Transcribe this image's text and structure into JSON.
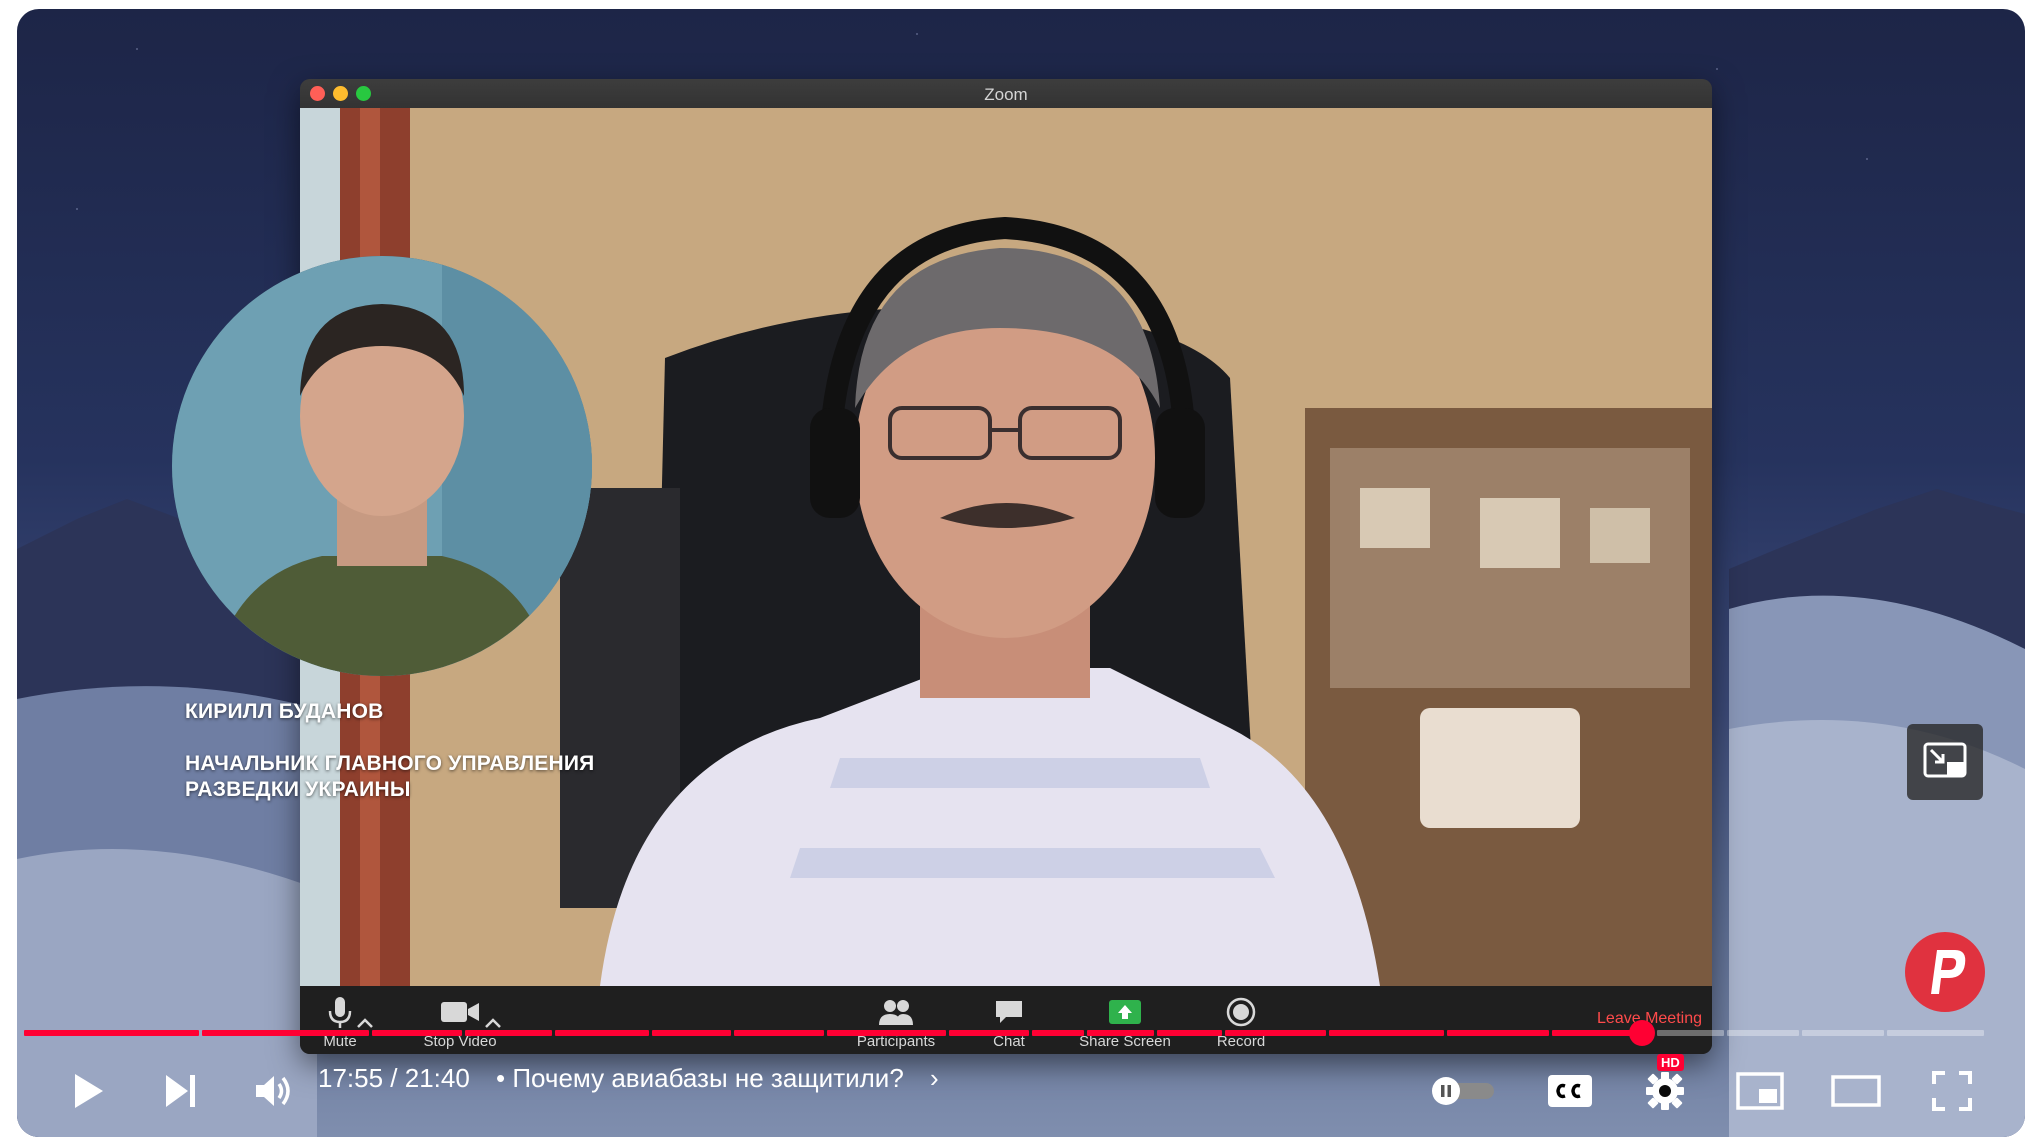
{
  "zoom": {
    "title": "Zoom",
    "toolbar": {
      "mute_label": "Mute",
      "stop_video_label": "Stop Video",
      "participants_label": "Participants",
      "chat_label": "Chat",
      "share_screen_label": "Share Screen",
      "record_label": "Record",
      "leave_label": "Leave Meeting"
    }
  },
  "overlay": {
    "name": "КИРИЛЛ БУДАНОВ",
    "position_line1": "НАЧАЛЬНИК ГЛАВНОГО УПРАВЛЕНИЯ",
    "position_line2": "РАЗВЕДКИ УКРАИНЫ"
  },
  "player": {
    "time": "17:55 / 21:40",
    "chapter_separator": "•",
    "chapter_title": "Почему авиабазы не защитили?",
    "chapter_chevron": "›",
    "hd_badge": "HD",
    "progress_fraction": 0.8256,
    "accent_color": "#ff0033",
    "icons": [
      "play-icon",
      "next-icon",
      "volume-icon",
      "autoplay-toggle-icon",
      "cc-icon",
      "settings-icon",
      "miniplayer-icon",
      "theater-icon",
      "fullscreen-icon"
    ]
  }
}
